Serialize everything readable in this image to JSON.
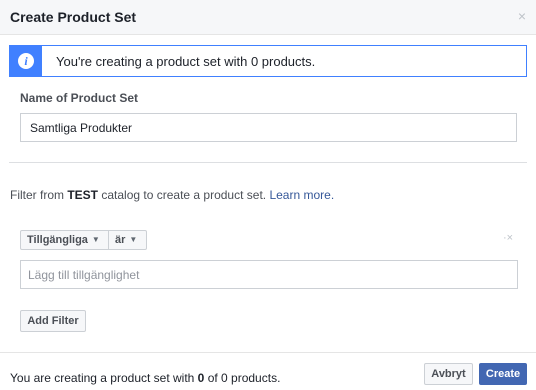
{
  "dialog": {
    "title": "Create Product Set",
    "close_glyph": "×"
  },
  "info": {
    "icon_letter": "i",
    "message": "You're creating a product set with 0 products."
  },
  "name_field": {
    "label": "Name of Product Set",
    "value": "Samtliga Produkter"
  },
  "filter": {
    "intro_prefix": "Filter from ",
    "catalog_name": "TEST",
    "intro_suffix": " catalog to create a product set. ",
    "learn_more": "Learn more.",
    "row": {
      "field": "Tillgängliga",
      "operator": "är",
      "remove_glyph": "·×",
      "value_placeholder": "Lägg till tillgänglighet"
    },
    "add_label": "Add Filter"
  },
  "footer": {
    "summary_prefix": "You are creating a product set with ",
    "summary_count": "0",
    "summary_suffix": " of 0 products.",
    "cancel_label": "Avbryt",
    "create_label": "Create"
  },
  "colors": {
    "accent": "#4080ff",
    "primary_button": "#4267b2",
    "link": "#365899"
  },
  "icons": [
    "close-icon",
    "info-icon",
    "caret-down-icon",
    "remove-icon"
  ]
}
